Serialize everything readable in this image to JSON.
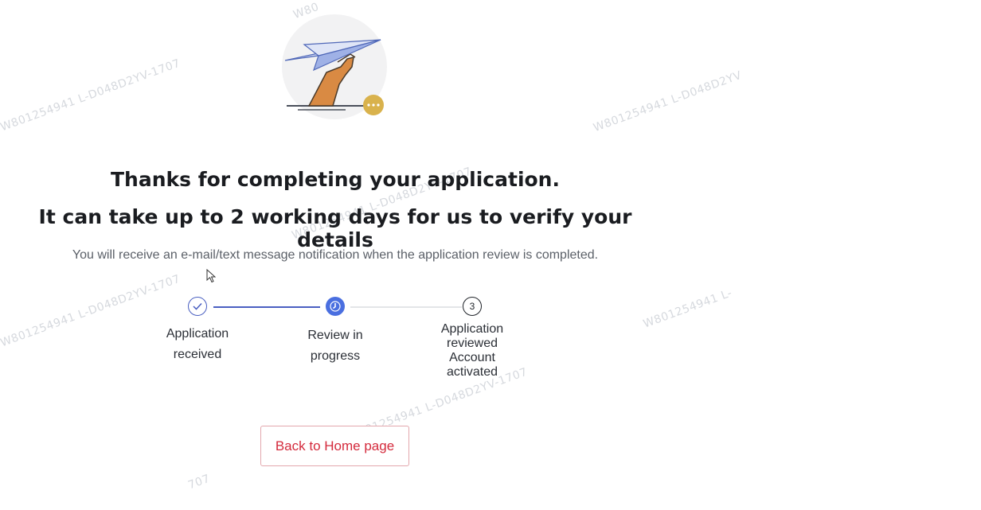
{
  "watermarks": [
    "W801254941 L-D048D2YV-1707",
    "W801254941 L-D048D2YV-1707",
    "W801254941 L-D048D2YV",
    "W801254941 L-",
    "W801254941 L-D048D2YV-1707",
    "W801254941 L-D048D2YV-1707",
    "W801254941 L-D048D2YV-1707",
    "W80",
    "707"
  ],
  "illustration": {
    "icon": "paper-plane-hand-icon",
    "badge_icon": "more-dots-icon",
    "badge_color": "#d9b24c"
  },
  "heading": {
    "line1": "Thanks for completing your application.",
    "line2": "It can take up to 2 working days for us to verify your details"
  },
  "notice": "You will receive an e-mail/text message notification when the application review is completed.",
  "steps": [
    {
      "label": "Application received",
      "status": "done",
      "icon": "check-icon"
    },
    {
      "label": "Review in progress",
      "status": "current",
      "icon": "clock-icon"
    },
    {
      "label_lines": [
        "Application",
        "reviewed",
        "Account",
        "activated"
      ],
      "status": "pending",
      "number": "3"
    }
  ],
  "accent_color": "#4a5fc1",
  "cta": {
    "label": "Back to Home page",
    "color": "#d42a3c"
  }
}
